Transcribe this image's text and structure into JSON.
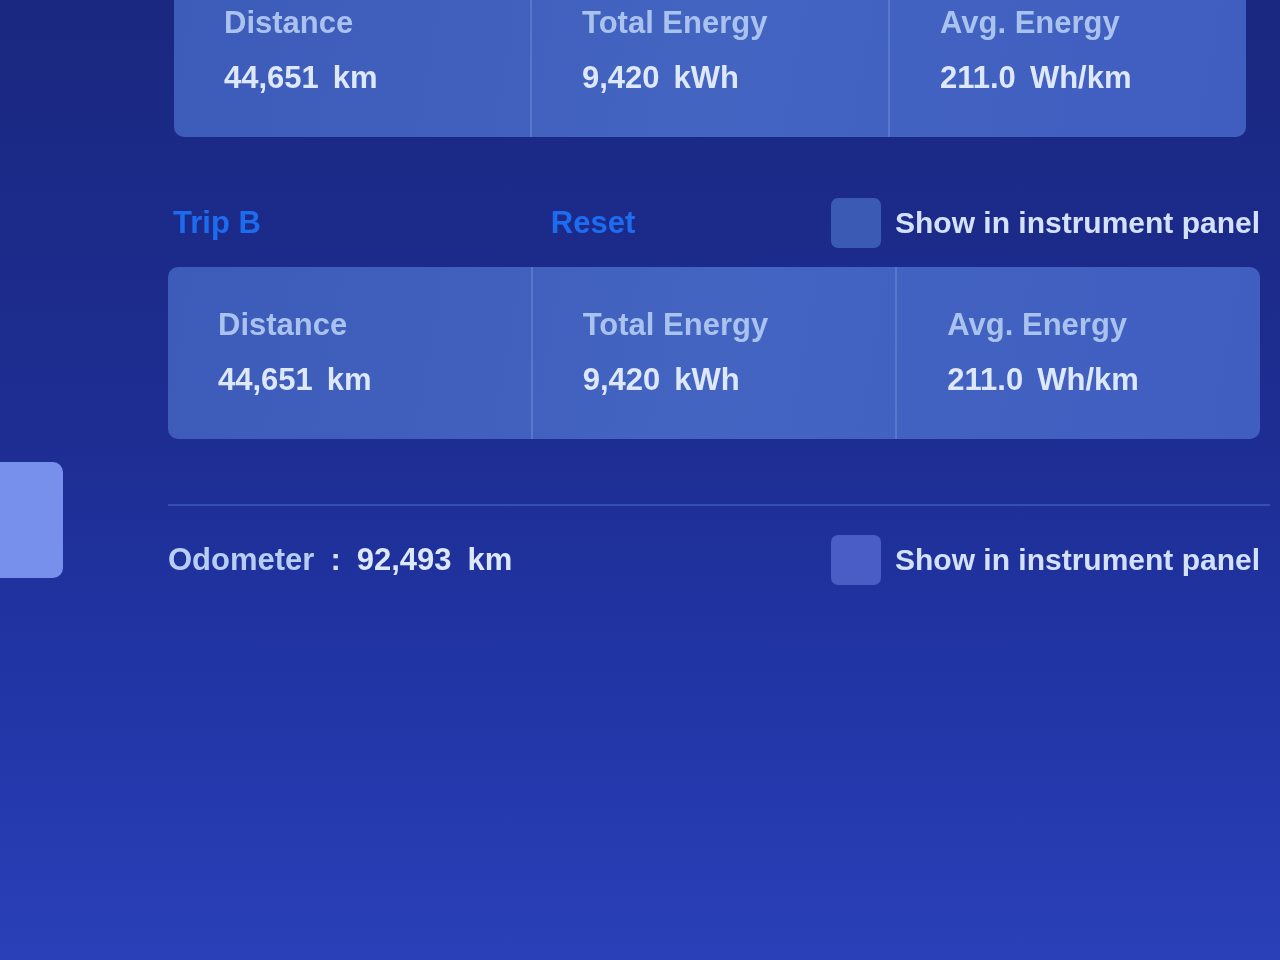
{
  "trips": [
    {
      "stats": [
        {
          "label": "Distance",
          "value": "44,651",
          "unit": "km"
        },
        {
          "label": "Total Energy",
          "value": "9,420",
          "unit": "kWh"
        },
        {
          "label": "Avg. Energy",
          "value": "211.0",
          "unit": "Wh/km"
        }
      ]
    },
    {
      "name": "Trip B",
      "reset_label": "Reset",
      "show_in_panel": {
        "label": "Show in instrument panel",
        "checked": false
      },
      "stats": [
        {
          "label": "Distance",
          "value": "44,651",
          "unit": "km"
        },
        {
          "label": "Total Energy",
          "value": "9,420",
          "unit": "kWh"
        },
        {
          "label": "Avg. Energy",
          "value": "211.0",
          "unit": "Wh/km"
        }
      ]
    }
  ],
  "odometer": {
    "label": "Odometer",
    "separator": ":",
    "value": "92,493",
    "unit": "km",
    "show_in_panel": {
      "label": "Show in instrument panel",
      "checked": false
    }
  }
}
